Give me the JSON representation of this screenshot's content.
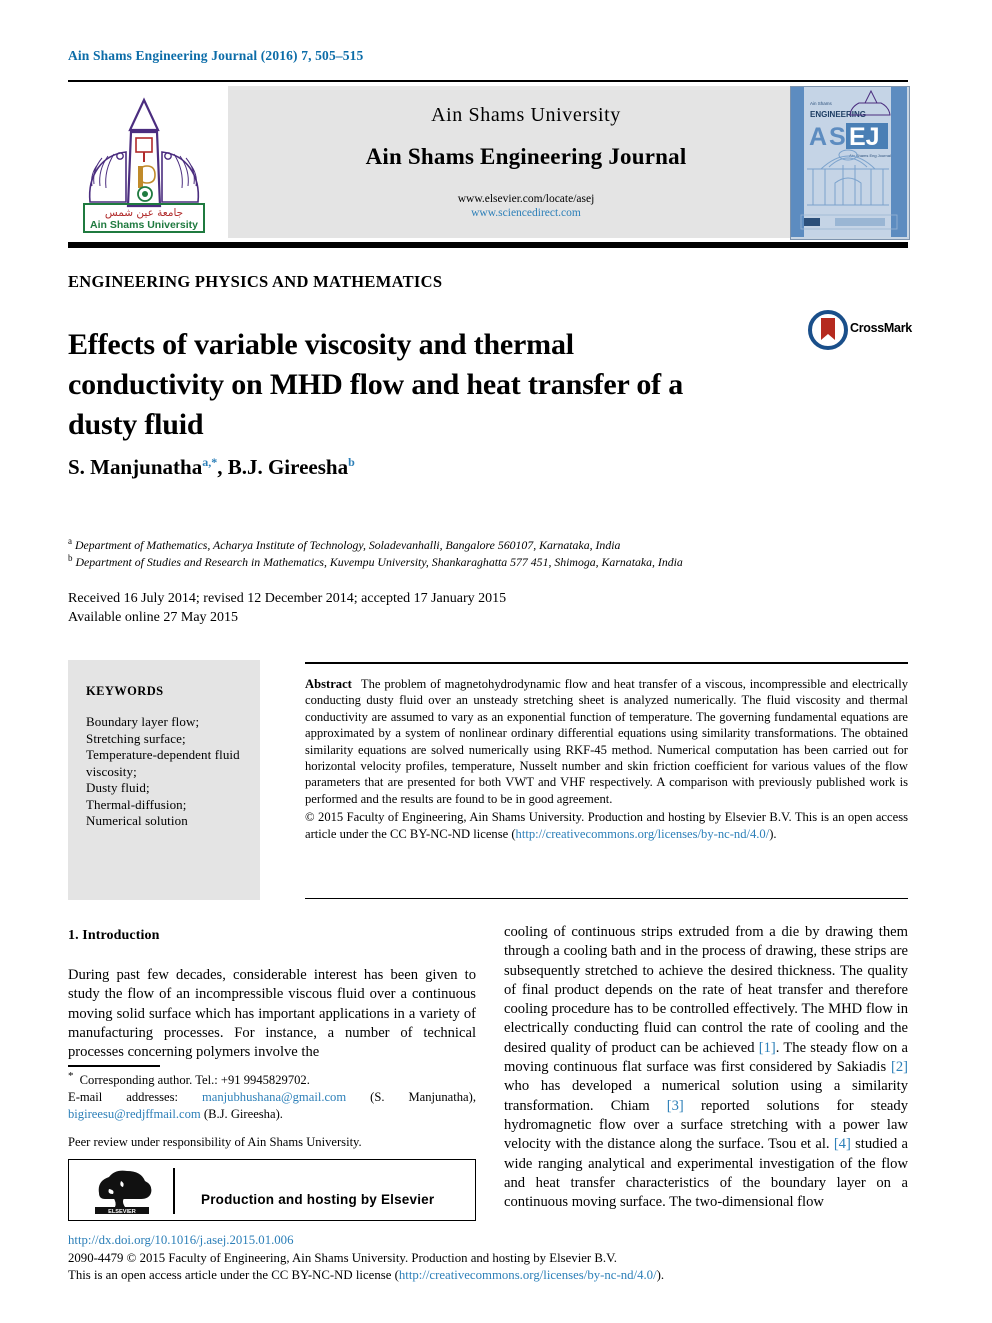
{
  "running_head": "Ain Shams Engineering Journal (2016) 7, 505–515",
  "masthead": {
    "university": "Ain Shams University",
    "journal_title": "Ain Shams Engineering Journal",
    "url_elsevier": "www.elsevier.com/locate/asej",
    "url_sciencedirect": "www.sciencedirect.com",
    "logo_caption_arabic": "جامعة عين شمس",
    "logo_caption_english": "Ain Shams University",
    "cover": {
      "top_small_text": "Ain Shams",
      "word_engineering": "ENGINEERING",
      "acronym_a": "A",
      "acronym_s": "S",
      "acronym_e": "E",
      "acronym_j": "J",
      "acronym_sub": "Ain Shams Engineering Journal"
    },
    "colors": {
      "panel_bg": "#e4e4e4",
      "link_blue": "#2c7fb8",
      "cover_blue": "#4a7fb5",
      "logo_purple": "#4b2d7f",
      "logo_green": "#1f7a3f"
    }
  },
  "section_label": "ENGINEERING PHYSICS AND MATHEMATICS",
  "article_title": "Effects of variable viscosity and thermal conductivity on MHD flow and heat transfer of a dusty fluid",
  "crossmark": {
    "label": "CrossMark",
    "ring_color": "#1a4f8a",
    "mark_color": "#b52a1f"
  },
  "authors": {
    "author1_name": "S. Manjunatha",
    "author1_sup": "a,*",
    "separator": ", ",
    "author2_name": "B.J. Gireesha",
    "author2_sup": "b"
  },
  "affiliations": [
    {
      "marker": "a",
      "text": "Department of Mathematics, Acharya Institute of Technology, Soladevanhalli, Bangalore 560107, Karnataka, India"
    },
    {
      "marker": "b",
      "text": "Department of Studies and Research in Mathematics, Kuvempu University, Shankaraghatta 577 451, Shimoga, Karnataka, India"
    }
  ],
  "dates": {
    "line1": "Received 16 July 2014; revised 12 December 2014; accepted 17 January 2015",
    "line2": "Available online 27 May 2015"
  },
  "keywords": {
    "heading": "KEYWORDS",
    "items_text": "Boundary layer flow;\nStretching surface;\nTemperature-dependent fluid viscosity;\nDusty fluid;\nThermal-diffusion;\nNumerical solution",
    "items": [
      "Boundary layer flow;",
      "Stretching surface;",
      "Temperature-dependent fluid viscosity;",
      "Dusty fluid;",
      "Thermal-diffusion;",
      "Numerical solution"
    ]
  },
  "abstract": {
    "heading": "Abstract",
    "body": "The problem of magnetohydrodynamic flow and heat transfer of a viscous, incompressible and electrically conducting dusty fluid over an unsteady stretching sheet is analyzed numerically. The fluid viscosity and thermal conductivity are assumed to vary as an exponential function of temperature. The governing fundamental equations are approximated by a system of nonlinear ordinary differential equations using similarity transformations. The obtained similarity equations are solved numerically using RKF-45 method. Numerical computation has been carried out for horizontal velocity profiles, temperature, Nusselt number and skin friction coefficient for various values of the flow parameters that are presented for both VWT and VHF respectively. A comparison with previously published work is performed and the results are found to be in good agreement.",
    "copyright_part1": "© 2015 Faculty of Engineering, Ain Shams University. Production and hosting by Elsevier B.V. This is an open access article under the CC BY-NC-ND license (",
    "copyright_link": "http://creativecommons.org/licenses/by-nc-nd/4.0/",
    "copyright_part2": ")."
  },
  "introduction": {
    "heading": "1. Introduction",
    "left_paragraph": "During past few decades, considerable interest has been given to study the flow of an incompressible viscous fluid over a continuous moving solid surface which has important applications in a variety of manufacturing processes. For instance, a number of technical processes concerning polymers involve the",
    "right_part1": "cooling of continuous strips extruded from a die by drawing them through a cooling bath and in the process of drawing, these strips are subsequently stretched to achieve the desired thickness. The quality of final product depends on the rate of heat transfer and therefore cooling procedure has to be controlled effectively. The MHD flow in electrically conducting fluid can control the rate of cooling and the desired quality of product can be achieved ",
    "ref1": "[1]",
    "right_part2": ". The steady flow on a moving continuous flat surface was first considered by Sakiadis ",
    "ref2": "[2]",
    "right_part3": " who has developed a numerical solution using a similarity transformation. Chiam ",
    "ref3": "[3]",
    "right_part4": " reported solutions for steady hydromagnetic flow over a surface stretching with a power law velocity with the distance along the surface. Tsou et al. ",
    "ref4": "[4]",
    "right_part5": " studied a wide ranging analytical and experimental investigation of the flow and heat transfer characteristics of the boundary layer on a continuous moving surface. The two-dimensional flow"
  },
  "footnotes": {
    "star": "*",
    "corresponding": " Corresponding author. Tel.: +91 9945829702.",
    "email_label": "E-mail addresses:",
    "email1": "manjubhushana@gmail.com",
    "email1_owner": "(S. Manjunatha),",
    "email2": "bigireesu@redjffmail.com",
    "email2_owner": "(B.J. Gireesha).",
    "peer_review": "Peer review under responsibility of Ain Shams University."
  },
  "elsevier_box": {
    "logo_word": "ELSEVIER",
    "text": "Production and hosting by Elsevier"
  },
  "bottom": {
    "doi": "http://dx.doi.org/10.1016/j.asej.2015.01.006",
    "issn_line": "2090-4479 © 2015 Faculty of Engineering, Ain Shams University. Production and hosting by Elsevier B.V.",
    "license_part1": "This is an open access article under the CC BY-NC-ND license (",
    "license_link": "http://creativecommons.org/licenses/by-nc-nd/4.0/",
    "license_part2": ")."
  }
}
